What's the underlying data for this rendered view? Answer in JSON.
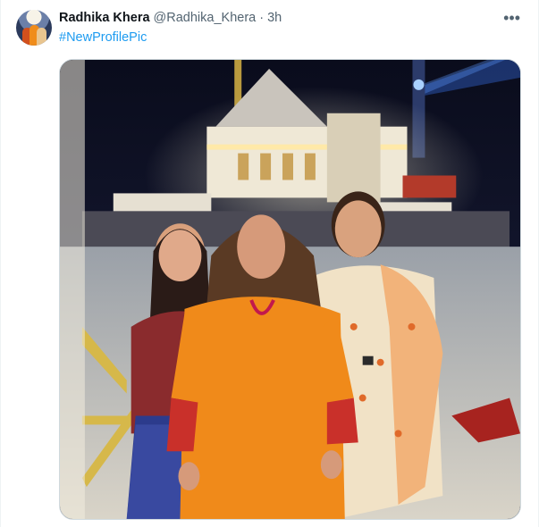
{
  "post": {
    "author_name": "Radhika Khera",
    "author_handle": "@Radhika_Khera",
    "separator": "·",
    "timestamp": "3h",
    "more_label": "•••",
    "hashtag": "#NewProfilePic"
  },
  "media": {
    "type": "photo",
    "scene": "night-temple-group-photo"
  },
  "icons": {
    "more": "more-horizontal-icon"
  },
  "colors": {
    "link": "#1d9bf0",
    "name": "#0f1419",
    "muted": "#536471",
    "border": "#cfd9de"
  }
}
